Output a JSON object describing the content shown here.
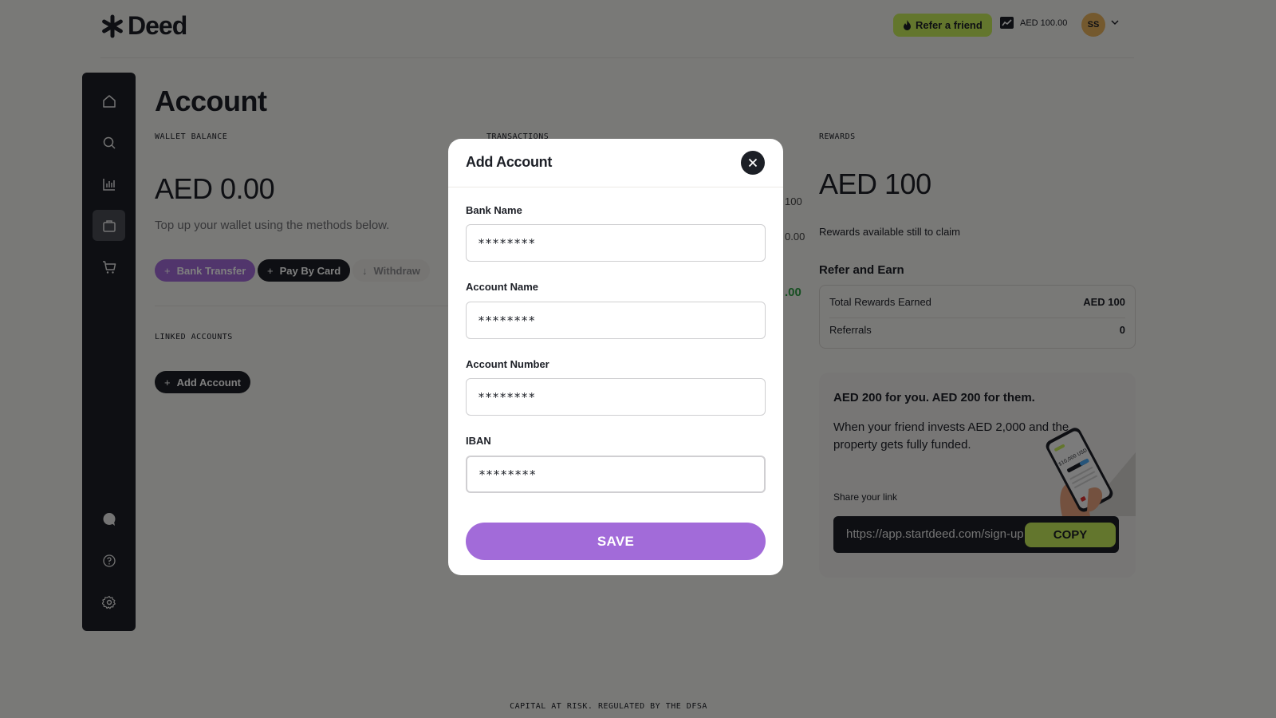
{
  "header": {
    "logo_text": "Deed",
    "refer_label": "Refer a friend",
    "balance": "AED 100.00",
    "avatar_initials": "SS"
  },
  "sidebar": {
    "items": [
      {
        "name": "home-icon",
        "active": false
      },
      {
        "name": "search-icon",
        "active": false
      },
      {
        "name": "chart-icon",
        "active": false
      },
      {
        "name": "wallet-icon",
        "active": true
      },
      {
        "name": "cart-icon",
        "active": false
      },
      {
        "name": "chat-icon",
        "active": false
      },
      {
        "name": "help-icon",
        "active": false
      },
      {
        "name": "gear-icon",
        "active": false
      }
    ]
  },
  "main": {
    "title": "Account",
    "wallet": {
      "label": "WALLET BALANCE",
      "amount": "AED 0.00",
      "hint": "Top up your wallet using the methods below.",
      "bank_transfer": "Bank Transfer",
      "pay_by_card": "Pay By Card",
      "withdraw": "Withdraw"
    },
    "linked": {
      "label": "LINKED ACCOUNTS",
      "add_account": "Add Account"
    },
    "transactions": {
      "label": "TRANSACTIONS",
      "amounts": [
        "100",
        "0.00",
        ".00"
      ]
    },
    "rewards": {
      "label": "REWARDS",
      "amount": "AED 100",
      "caption": "Rewards available still to claim",
      "refer_heading": "Refer and Earn",
      "total_label": "Total Rewards Earned",
      "total_value": "AED 100",
      "referrals_label": "Referrals",
      "referrals_value": "0"
    },
    "promo": {
      "headline": "AED 200 for you. AED 200 for them.",
      "body": "When your friend invests AED 2,000 and the property gets fully funded.",
      "share_label": "Share your link",
      "link": "https://app.startdeed.com/sign-up",
      "copy_label": "COPY",
      "phone_amount": "$10,000 USD"
    }
  },
  "footer": {
    "text": "CAPITAL AT RISK. REGULATED BY THE DFSA"
  },
  "modal": {
    "title": "Add Account",
    "fields": [
      {
        "label": "Bank Name",
        "value": "********"
      },
      {
        "label": "Account Name",
        "value": "********"
      },
      {
        "label": "Account Number",
        "value": "********"
      },
      {
        "label": "IBAN",
        "value": "********"
      }
    ],
    "save_label": "SAVE"
  },
  "colors": {
    "accent_purple": "#a26bd9",
    "accent_lime": "#c7ec5a",
    "dark": "#1c1f26",
    "positive_green": "#2f9e44"
  }
}
